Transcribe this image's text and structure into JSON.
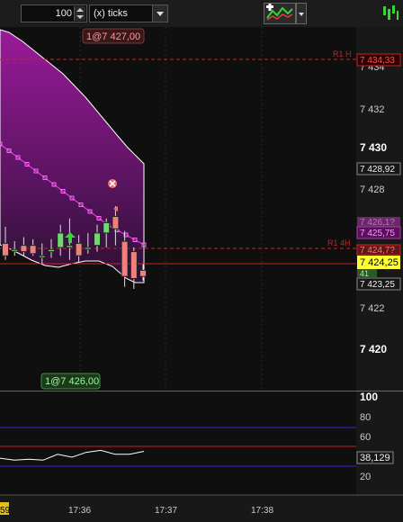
{
  "toolbar": {
    "period_value": "100",
    "period_unit": "(x) ticks",
    "indicator_icon": "chart-indicator-icon",
    "logo_icon": "prorealtime-logo-icon"
  },
  "price_axis": {
    "ticks": [
      "7 434",
      "7 432",
      "7 430",
      "7 428",
      "7 426",
      "7 424",
      "7 422",
      "7 420"
    ],
    "bold_ticks": [
      "7 430",
      "7 420"
    ],
    "labels": {
      "r1h": "7 434,33",
      "high": "7 428,92",
      "mid": "7 425,75",
      "current": "7 424,25",
      "low": "7 423,25",
      "hidden_a": "7 426,1?",
      "hidden_b": "7 424,7?",
      "hidden_c": "41"
    }
  },
  "levels": {
    "r1h_label": "R1 H",
    "r14h_label": "R1 4H"
  },
  "chart_tags": {
    "top": "1@7 427,00",
    "bottom": "1@7 426,00"
  },
  "oscillator": {
    "ticks": [
      "100",
      "80",
      "60",
      "40",
      "20"
    ],
    "current_value": "38,129",
    "levels": [
      70,
      50,
      30
    ],
    "series": [
      32,
      30,
      31,
      30,
      36,
      33,
      38,
      40,
      36,
      36,
      39
    ]
  },
  "time_axis": {
    "labels": [
      "17:36",
      "17:37",
      "17:38"
    ],
    "partial_label": "59"
  },
  "colors": {
    "background": "#111111",
    "band_fill": "#7a1a7a",
    "bull_candle": "#6fd96f",
    "bear_candle": "#f08080",
    "level_red": "#cc2222",
    "osc_blue": "#2a2ad0"
  },
  "candles": [
    {
      "o": 7425.2,
      "h": 7426.0,
      "l": 7424.4,
      "c": 7424.6
    },
    {
      "o": 7424.9,
      "h": 7425.3,
      "l": 7424.6,
      "c": 7424.9
    },
    {
      "o": 7425.1,
      "h": 7425.5,
      "l": 7424.6,
      "c": 7424.8
    },
    {
      "o": 7425.1,
      "h": 7425.4,
      "l": 7424.6,
      "c": 7424.7
    },
    {
      "o": 7424.6,
      "h": 7425.2,
      "l": 7424.2,
      "c": 7424.6
    },
    {
      "o": 7424.8,
      "h": 7425.4,
      "l": 7424.5,
      "c": 7424.9
    },
    {
      "o": 7425.0,
      "h": 7426.1,
      "l": 7424.6,
      "c": 7425.7
    },
    {
      "o": 7425.0,
      "h": 7426.4,
      "l": 7424.4,
      "c": 7425.1
    },
    {
      "o": 7425.2,
      "h": 7425.6,
      "l": 7424.3,
      "c": 7424.6
    },
    {
      "o": 7425.0,
      "h": 7425.7,
      "l": 7424.7,
      "c": 7425.0
    },
    {
      "o": 7425.1,
      "h": 7426.1,
      "l": 7424.8,
      "c": 7425.7
    },
    {
      "o": 7425.7,
      "h": 7426.4,
      "l": 7425.0,
      "c": 7426.2
    },
    {
      "o": 7426.5,
      "h": 7427.0,
      "l": 7425.1,
      "c": 7425.9
    },
    {
      "o": 7425.3,
      "h": 7425.8,
      "l": 7423.1,
      "c": 7423.6
    },
    {
      "o": 7424.8,
      "h": 7425.0,
      "l": 7423.0,
      "c": 7423.5
    },
    {
      "o": 7423.9,
      "h": 7424.2,
      "l": 7423.4,
      "c": 7423.6
    }
  ]
}
